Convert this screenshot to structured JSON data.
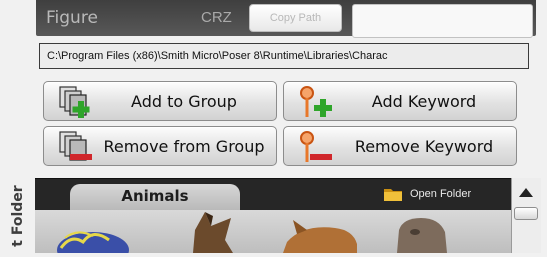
{
  "top": {
    "figure_label": "Figure",
    "figure_code": "CRZ",
    "copy_path_label": "Copy Path"
  },
  "path_bar": {
    "value": "C:\\Program Files (x86)\\Smith Micro\\Poser 8\\Runtime\\Libraries\\Charac"
  },
  "buttons": {
    "add_group": "Add to Group",
    "add_keyword": "Add Keyword",
    "remove_group": "Remove from Group",
    "remove_keyword": "Remove Keyword"
  },
  "library": {
    "side_label": "t Folder",
    "tab_label": "Animals",
    "open_folder_label": "Open Folder"
  },
  "colors": {
    "add_green": "#2fa52a",
    "remove_red": "#d0262b",
    "keyword_orange": "#e8782a",
    "folder_yellow": "#e5b21f"
  },
  "icons": [
    "documents-icon",
    "plus-icon",
    "minus-icon",
    "keyword-tag-icon",
    "folder-icon",
    "scroll-up-arrow-icon"
  ]
}
